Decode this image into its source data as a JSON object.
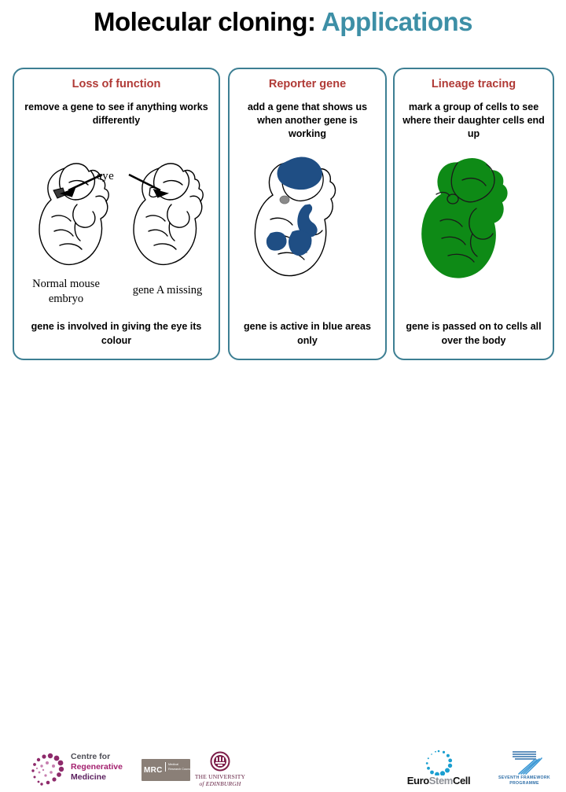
{
  "slide": {
    "title_main": "Molecular cloning:",
    "title_accent": "Applications",
    "accent_color": "#3d8fa6",
    "header_color": "#b03a36",
    "panel_border_color": "#3d7f93"
  },
  "columns": [
    {
      "id": "loss-of-function",
      "header": "Loss of function",
      "subtitle": "remove a gene to see if anything works differently",
      "footer": "gene is involved in giving the eye its colour",
      "figure": {
        "kind": "two-mouse-embryo-line-drawings",
        "callout": "eye",
        "label_left": "Normal mouse embryo",
        "label_right": "gene A missing",
        "left_eye_fill": "#3a3a3a",
        "right_eye_fill": "#ffffff"
      }
    },
    {
      "id": "reporter-gene",
      "header": "Reporter gene",
      "subtitle": "add a gene that shows us when another gene is working",
      "footer": "gene is active in blue areas only",
      "figure": {
        "kind": "embryo-with-blue-patches",
        "fill_color": "#1f4e84",
        "accent_color": "#8a8a8a",
        "outline_color": "#000000"
      }
    },
    {
      "id": "lineage-tracing",
      "header": "Lineage tracing",
      "subtitle": "mark a group of cells to see where their daughter cells end up",
      "footer": "gene is passed on to cells all over the body",
      "figure": {
        "kind": "fully-filled-green-embryo",
        "fill_color": "#0e8a16",
        "outline_color": "#000000"
      }
    }
  ],
  "footer_logos": [
    {
      "id": "crm",
      "line1": "Centre for",
      "line2": "Regenerative",
      "line3": "Medicine",
      "color1": "#4d4d55",
      "color2": "#a31f6e",
      "color3": "#5a1f5e"
    },
    {
      "id": "mrc",
      "acronym": "MRC",
      "expansion": "Medical Research Council",
      "background": "#8a7f77"
    },
    {
      "id": "university-of-edinburgh",
      "line1": "THE UNIVERSITY",
      "line2": "of EDINBURGH",
      "color": "#5f1a3c"
    },
    {
      "id": "eurostemcell",
      "part1": "Euro",
      "part2": "Stem",
      "part3": "Cell",
      "dot_color": "#1b9fd0"
    },
    {
      "id": "seventh-framework-programme",
      "line1": "SEVENTH FRAMEWORK",
      "line2": "PROGRAMME",
      "color": "#2f6fa8"
    }
  ]
}
